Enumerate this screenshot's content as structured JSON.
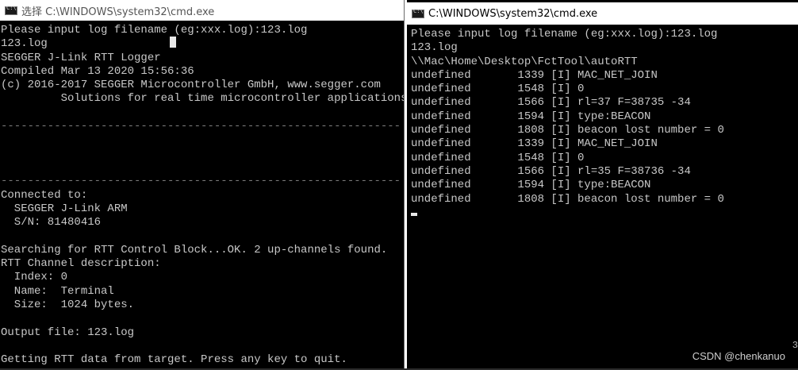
{
  "left_window": {
    "title": "选择 C:\\WINDOWS\\system32\\cmd.exe",
    "lines": [
      "Please input log filename (eg:xxx.log):123.log",
      "123.log",
      "SEGGER J-Link RTT Logger",
      "Compiled Mar 13 2020 15:56:36",
      "(c) 2016-2017 SEGGER Microcontroller GmbH, www.segger.com",
      "         Solutions for real time microcontroller applications",
      "",
      "------------------------------------------------------------",
      "",
      "",
      "",
      "------------------------------------------------------------",
      "Connected to:",
      "  SEGGER J-Link ARM",
      "  S/N: 81480416",
      "",
      "Searching for RTT Control Block...OK. 2 up-channels found.",
      "RTT Channel description:",
      "  Index: 0",
      "  Name:  Terminal",
      "  Size:  1024 bytes.",
      "",
      "Output file: 123.log",
      "",
      "Getting RTT data from target. Press any key to quit.",
      "------------------------------------------------------------"
    ]
  },
  "right_window": {
    "title": "C:\\WINDOWS\\system32\\cmd.exe",
    "lines": [
      "Please input log filename (eg:xxx.log):123.log",
      "123.log",
      "\\\\Mac\\Home\\Desktop\\FctTool\\autoRTT",
      "undefined       1339 [I] MAC_NET_JOIN",
      "undefined       1548 [I] 0",
      "undefined       1566 [I] rl=37 F=38735 -34",
      "undefined       1594 [I] type:BEACON",
      "undefined       1808 [I] beacon lost number = 0",
      "undefined       1339 [I] MAC_NET_JOIN",
      "undefined       1548 [I] 0",
      "undefined       1566 [I] rl=35 F=38736 -34",
      "undefined       1594 [I] type:BEACON",
      "undefined       1808 [I] beacon lost number = 0"
    ]
  },
  "watermark": "CSDN @chenkanuo",
  "edge_mark": "3",
  "colors": {
    "console_bg": "#000000",
    "console_text": "#c8c8c8",
    "titlebar_bg": "#ffffff"
  }
}
